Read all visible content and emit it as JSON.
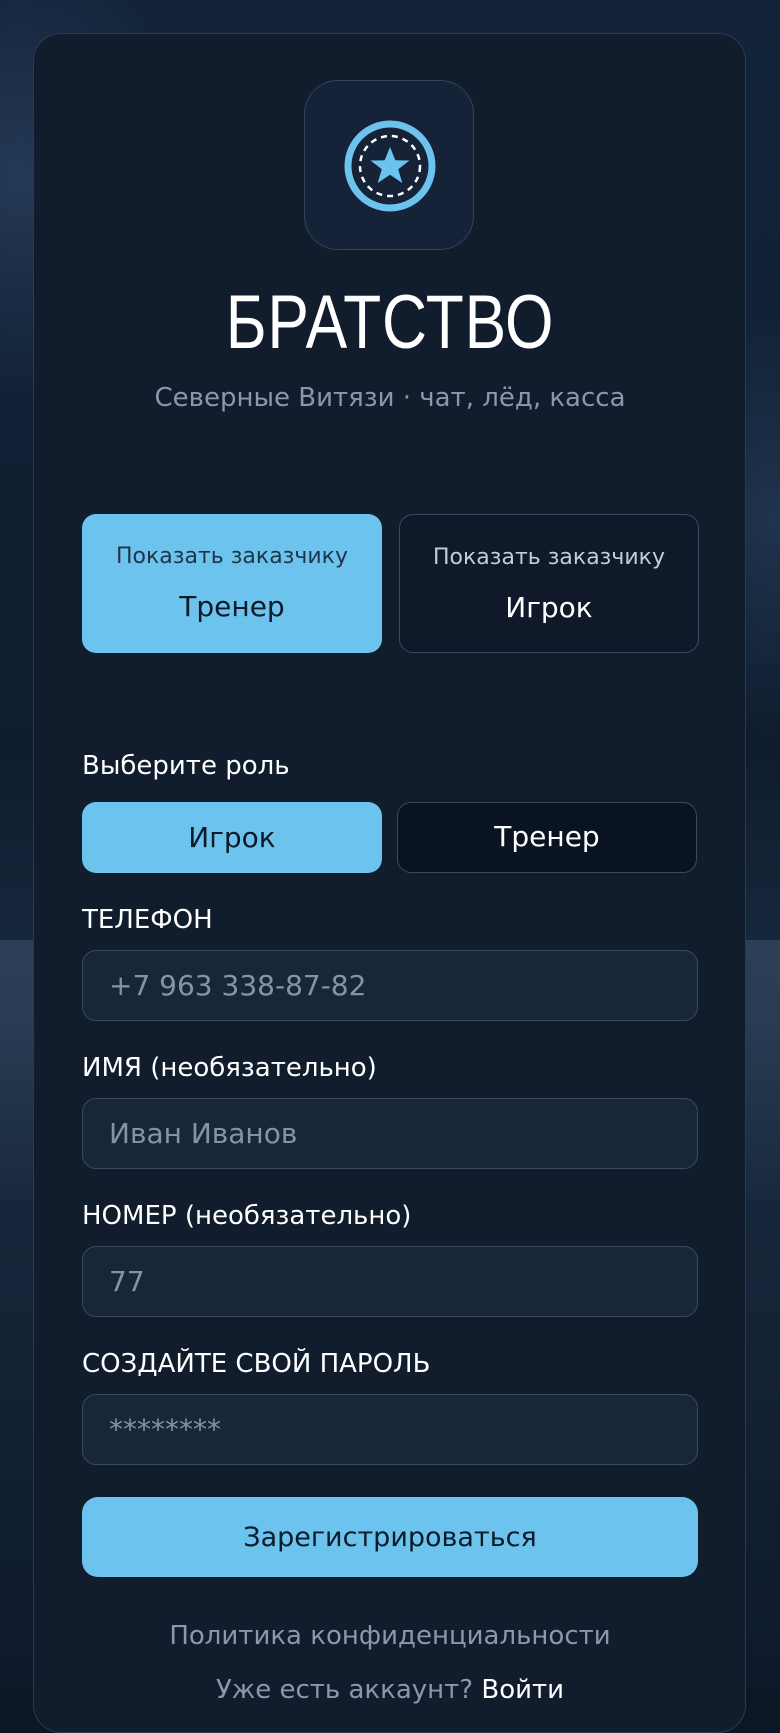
{
  "app": {
    "title": "БРАТСТВО",
    "subtitle": "Северные Витязи · чат, лёд, касса",
    "logo_icon": "star-badge-icon"
  },
  "demo": {
    "buttons": [
      {
        "small": "Показать заказчику",
        "label": "Тренер",
        "active": true
      },
      {
        "small": "Показать заказчику",
        "label": "Игрок",
        "active": false
      }
    ]
  },
  "role": {
    "label": "Выберите роль",
    "options": [
      {
        "label": "Игрок",
        "selected": true
      },
      {
        "label": "Тренер",
        "selected": false
      }
    ]
  },
  "form": {
    "phone": {
      "label": "ТЕЛЕФОН",
      "placeholder": "+7 963 338-87-82",
      "value": ""
    },
    "name": {
      "label": "ИМЯ (необязательно)",
      "placeholder": "Иван Иванов",
      "value": ""
    },
    "number": {
      "label": "НОМЕР (необязательно)",
      "placeholder": "77",
      "value": ""
    },
    "password": {
      "label": "СОЗДАЙТЕ СВОЙ ПАРОЛЬ",
      "placeholder": "********",
      "value": ""
    },
    "submit_label": "Зарегистрироваться"
  },
  "footer": {
    "policy": "Политика конфиденциальности",
    "login_prompt": "Уже есть аккаунт?",
    "login_link": "Войти"
  },
  "colors": {
    "accent": "#6cc4ee",
    "card_bg": "#111c2d",
    "field_bg": "#18263a",
    "border": "#3b4a60",
    "muted_text": "#8b98ab"
  }
}
